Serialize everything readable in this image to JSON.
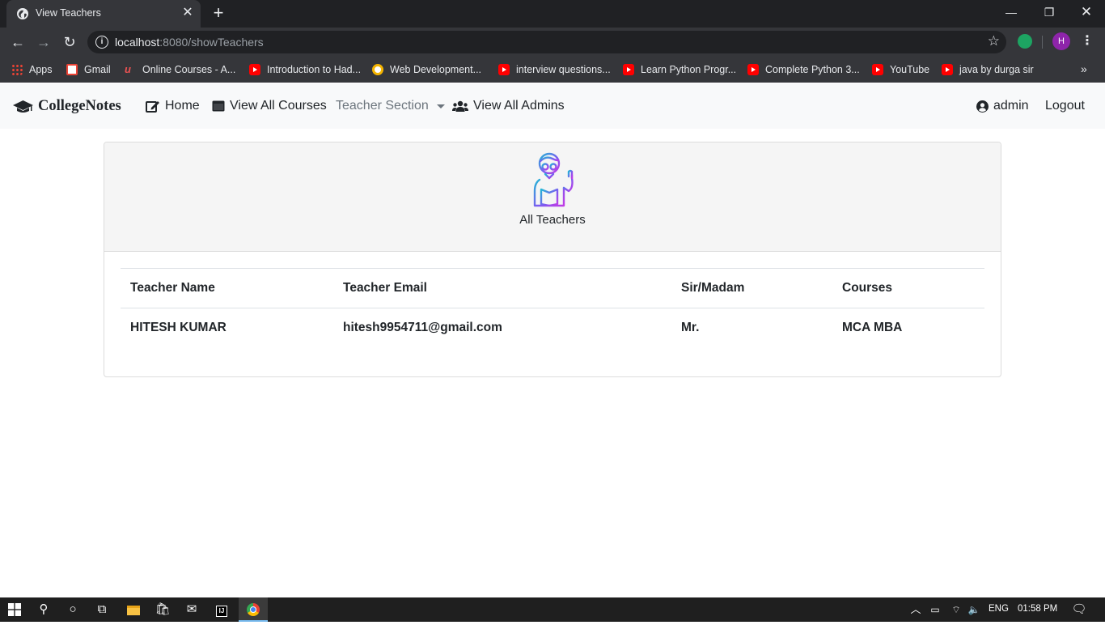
{
  "browser": {
    "tab_title": "View Teachers",
    "url_host": "localhost",
    "url_rest": ":8080/showTeachers",
    "profile_initial": "H",
    "bookmarks": [
      {
        "label": "Apps",
        "icon": "apps-grid-icon"
      },
      {
        "label": "Gmail",
        "icon": "gmail-icon"
      },
      {
        "label": "Online Courses - A...",
        "icon": "udemy-icon"
      },
      {
        "label": "Introduction to Had...",
        "icon": "youtube-icon"
      },
      {
        "label": "Web Development...",
        "icon": "web-icon"
      },
      {
        "label": "interview questions...",
        "icon": "youtube-icon"
      },
      {
        "label": "Learn Python Progr...",
        "icon": "youtube-icon"
      },
      {
        "label": "Complete Python 3...",
        "icon": "youtube-icon"
      },
      {
        "label": "YouTube",
        "icon": "youtube-icon"
      },
      {
        "label": "java by durga sir",
        "icon": "youtube-icon"
      }
    ]
  },
  "navbar": {
    "brand": "CollegeNotes",
    "home": "Home",
    "view_courses": "View All Courses",
    "teacher_section": "Teacher Section",
    "view_admins": "View All Admins",
    "user": "admin",
    "logout": "Logout"
  },
  "card": {
    "title": "All Teachers"
  },
  "table": {
    "headers": [
      "Teacher Name",
      "Teacher Email",
      "Sir/Madam",
      "Courses"
    ],
    "rows": [
      [
        "HITESH KUMAR",
        "hitesh9954711@gmail.com",
        "Mr.",
        "MCA MBA"
      ]
    ]
  },
  "taskbar": {
    "lang": "ENG",
    "time": "01:58 PM"
  },
  "colors": {
    "chrome_dark": "#202124",
    "chrome_toolbar": "#35363a",
    "navbar_bg": "#f8f9fa",
    "card_header_bg": "#f5f5f5",
    "taskbar_bg": "#1f1f1f"
  }
}
